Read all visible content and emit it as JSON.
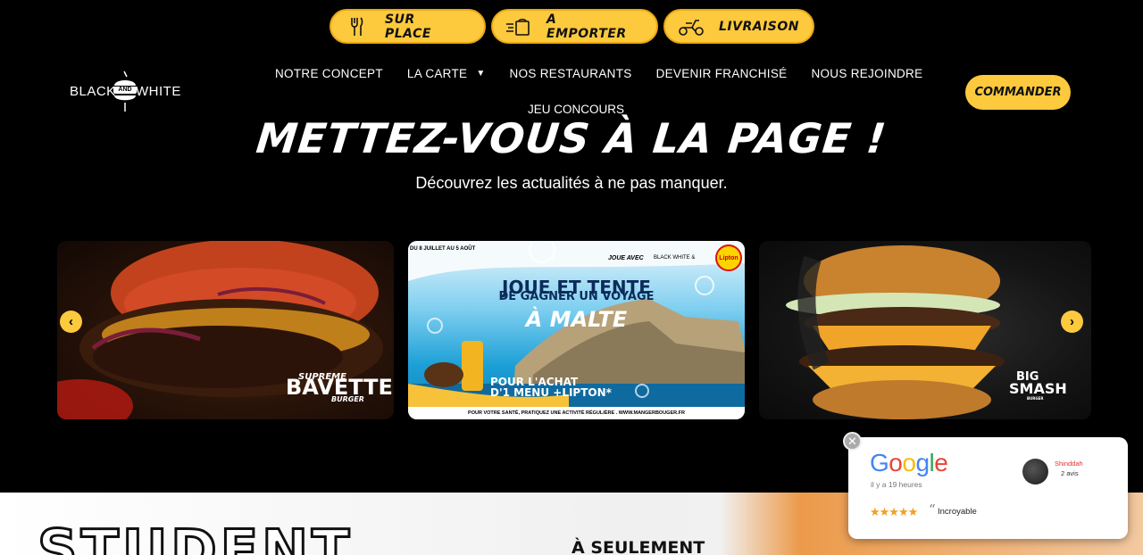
{
  "order_modes": [
    {
      "label": "SUR PLACE",
      "icon": "fork-knife-icon"
    },
    {
      "label": "A EMPORTER",
      "icon": "takeaway-bag-icon"
    },
    {
      "label": "LIVRAISON",
      "icon": "scooter-icon"
    }
  ],
  "logo": {
    "left": "BLACK",
    "middle": "AND",
    "right": "WHITE"
  },
  "nav": {
    "items": [
      "NOTRE CONCEPT",
      "LA CARTE",
      "NOS RESTAURANTS",
      "DEVENIR FRANCHISÉ",
      "NOUS REJOINDRE"
    ],
    "extra": "JEU CONCOURS"
  },
  "order_button": "COMMANDER",
  "hero": {
    "title": "METTEZ-VOUS À LA PAGE !",
    "subtitle": "Découvrez les actualités à ne pas manquer."
  },
  "carousel": {
    "prev_icon": "chevron-left-icon",
    "next_icon": "chevron-right-icon",
    "cards": [
      {
        "line1": "SUPREME",
        "line2": "BAVETTE",
        "line3": "BURGER"
      },
      {
        "date": "DU 8 JUILLET AU 5 AOÛT",
        "joue": "JOUE AVEC",
        "brand": "BLACK WHITE &",
        "lipton": "Lipton",
        "headline1": "JOUE ET TENTE",
        "headline2": "DE GAGNER UN VOYAGE",
        "destination": "À MALTE",
        "offer1": "POUR L'ACHAT",
        "offer2": "D'1 MENU +LIPTON*",
        "footer": "POUR VOTRE SANTÉ, PRATIQUEZ UNE ACTIVITÉ RÉGULIÈRE . WWW.MANGERBOUGER.FR"
      },
      {
        "line1": "BIG",
        "line2": "SMASH",
        "line3": "BURGER"
      }
    ]
  },
  "promo": {
    "big": "STUDENT",
    "small": "À SEULEMENT"
  },
  "review": {
    "brand": "Google",
    "time": "il y a 19 heures",
    "author": "Shinddah",
    "count": "2 avis",
    "stars": "★★★★★",
    "quote": "“",
    "text": "Incroyable"
  },
  "colors": {
    "accent": "#fdc93d",
    "background": "#000000"
  }
}
